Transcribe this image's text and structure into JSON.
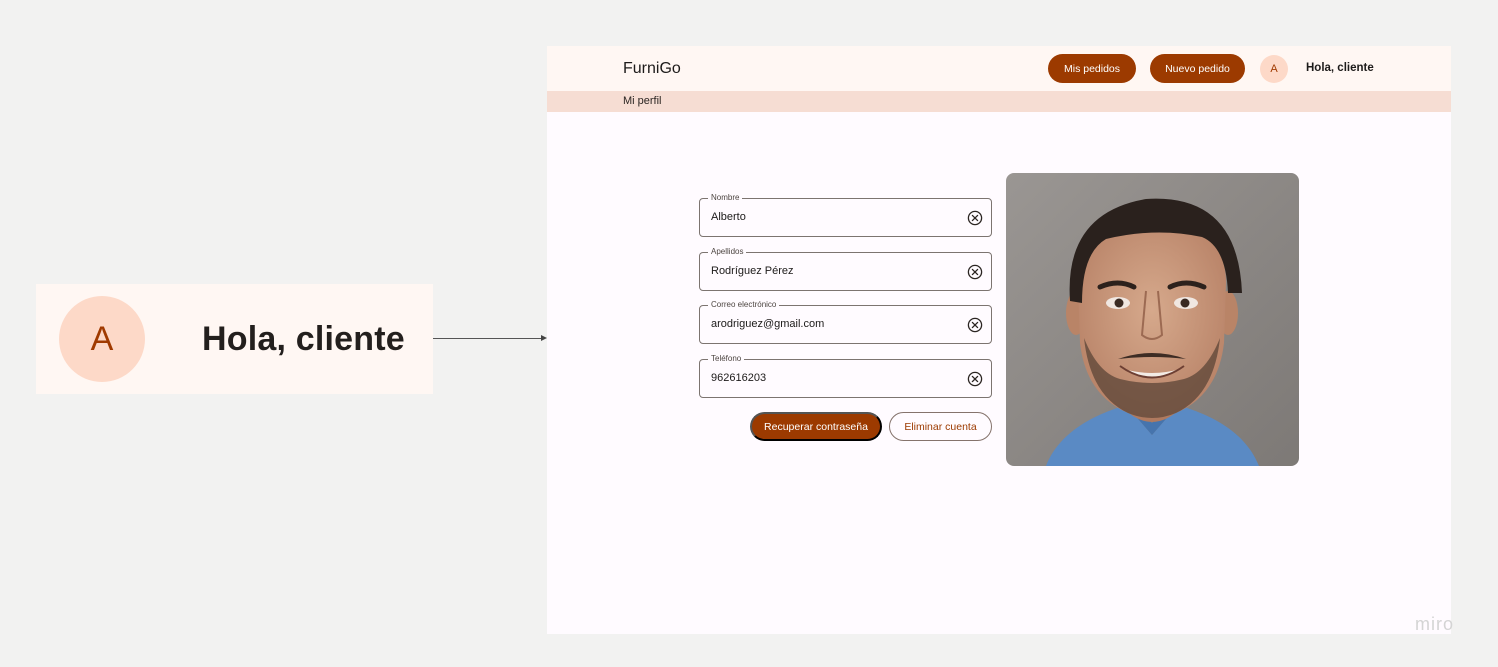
{
  "callout": {
    "avatar_letter": "A",
    "greeting": "Hola, cliente"
  },
  "app": {
    "brand": "FurniGo",
    "nav": {
      "orders_label": "Mis pedidos",
      "new_order_label": "Nuevo pedido"
    },
    "user": {
      "avatar_letter": "A",
      "greeting": "Hola, cliente"
    },
    "breadcrumb": "Mi perfil"
  },
  "form": {
    "fields": [
      {
        "label": "Nombre",
        "value": "Alberto"
      },
      {
        "label": "Apellidos",
        "value": "Rodríguez Pérez"
      },
      {
        "label": "Correo electrónico",
        "value": "arodriguez@gmail.com"
      },
      {
        "label": "Teléfono",
        "value": "962616203"
      }
    ],
    "recover_password_label": "Recuperar contraseña",
    "delete_account_label": "Eliminar cuenta",
    "clear_icon": "circle-x-icon"
  },
  "profile_photo": {
    "icon": "profile-photo"
  },
  "watermark": "miro",
  "colors": {
    "primary": "#9c3a00",
    "avatar_bg": "#fdd9c8",
    "topbar_bg": "#fff7f3",
    "subbar_bg": "#f6ddd3",
    "canvas_bg": "#f2f2f1"
  }
}
